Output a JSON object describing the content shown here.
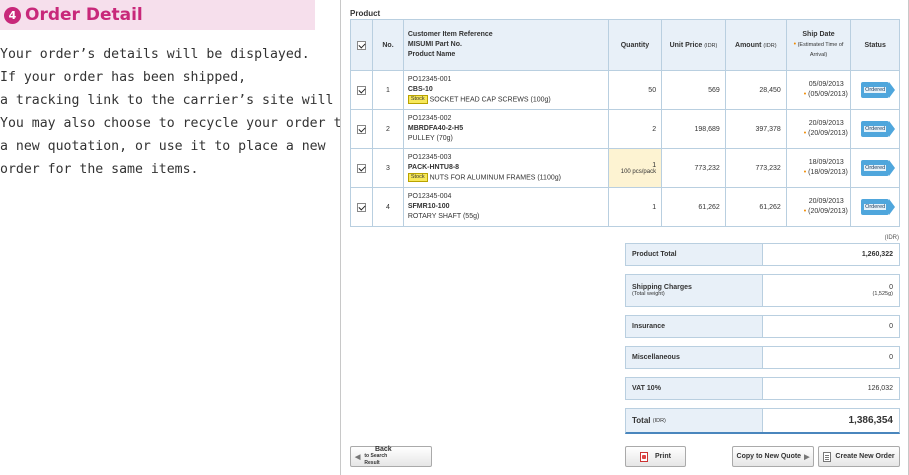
{
  "guide": {
    "step_number": "4",
    "title": "Order Detail",
    "lines": [
      "Your order’s details will be displayed.",
      "If your order has been shipped,",
      "a tracking link to the carrier’s site will appear.",
      "You may also choose to recycle your order to",
      "a new quotation, or use it to place a new",
      "order for the same items."
    ]
  },
  "panel": {
    "label": "Product",
    "headers": {
      "no": "No.",
      "ref_line1": "Customer Item Reference",
      "ref_line2": "MISUMI Part No.",
      "ref_line3": "Product Name",
      "quantity": "Quantity",
      "unit_price": "Unit Price",
      "unit_price_unit": "(IDR)",
      "amount": "Amount",
      "amount_unit": "(IDR)",
      "ship_date": "Ship Date",
      "ship_date_sub1": "(Estimated Time of",
      "ship_date_sub2": "Arrival)",
      "status": "Status"
    },
    "rows": [
      {
        "no": "1",
        "ref": "PO12345-001",
        "part": "CBS-10",
        "stock": "Stock",
        "name": "SOCKET HEAD CAP SCREWS (100g)",
        "qty": "50",
        "qty_sub": "",
        "unit_price": "569",
        "amount": "28,450",
        "ship": "05/09/2013",
        "eta": "(05/09/2013)",
        "status": "Ordered"
      },
      {
        "no": "2",
        "ref": "PO12345-002",
        "part": "MBRDFA40-2-H5",
        "stock": "",
        "name": "PULLEY (70g)",
        "qty": "2",
        "qty_sub": "",
        "unit_price": "198,689",
        "amount": "397,378",
        "ship": "20/09/2013",
        "eta": "(20/09/2013)",
        "status": "Ordered"
      },
      {
        "no": "3",
        "ref": "PO12345-003",
        "part": "PACK-HNTU8-8",
        "stock": "Stock",
        "name": "NUTS FOR ALUMINUM FRAMES (1100g)",
        "qty": "1",
        "qty_sub": "100 pcs/pack",
        "unit_price": "773,232",
        "amount": "773,232",
        "ship": "18/09/2013",
        "eta": "(18/09/2013)",
        "status": "Ordered"
      },
      {
        "no": "4",
        "ref": "PO12345-004",
        "part": "SFMR10-100",
        "stock": "",
        "name": "ROTARY SHAFT (55g)",
        "qty": "1",
        "qty_sub": "",
        "unit_price": "61,262",
        "amount": "61,262",
        "ship": "20/09/2013",
        "eta": "(20/09/2013)",
        "status": "Ordered"
      }
    ],
    "currency_note": "(IDR)",
    "summary": {
      "product_total_label": "Product Total",
      "product_total": "1,260,322",
      "shipping_label": "Shipping Charges",
      "shipping_sub": "(Total weight)",
      "shipping": "0",
      "shipping_weight": "(1,525g)",
      "insurance_label": "Insurance",
      "insurance": "0",
      "misc_label": "Miscellaneous",
      "misc": "0",
      "vat_label": "VAT 10%",
      "vat": "126,032",
      "total_label": "Total",
      "total_unit": "(IDR)",
      "total": "1,386,354"
    },
    "buttons": {
      "back": "Back",
      "back_sub": "to Search Result",
      "print": "Print",
      "copy_quote": "Copy to New Quote",
      "new_order": "Create New Order"
    }
  }
}
